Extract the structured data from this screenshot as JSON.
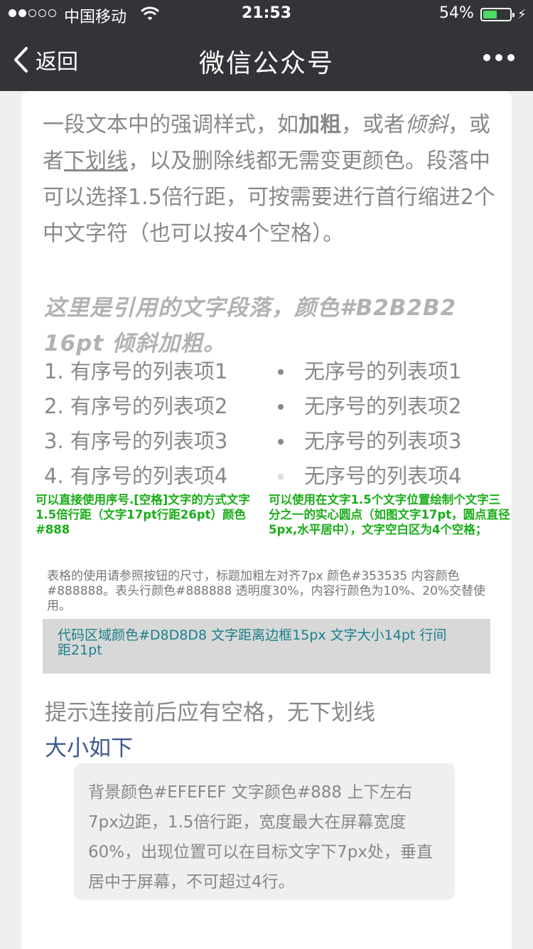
{
  "status_bar": {
    "carrier": "中国移动",
    "time": "21:53",
    "battery": "54%",
    "battery_level": 0.54
  },
  "nav": {
    "back_label": "返回",
    "title": "微信公众号"
  },
  "content": {
    "paragraph": {
      "p1": "一段文本中的强调样式，如",
      "bold": "加粗",
      "p2": "，或者",
      "italic": "倾斜",
      "p3": "，或者",
      "underline": "下划线",
      "p4": "，以及删除线都无需变更颜色。段落中可以选择1.5倍行距，可按需要进行首行缩进2个中文字符（也可以按4个空格）。"
    },
    "quote": "这里是引用的文字段落，颜色#B2B2B2 16pt 倾斜加粗。",
    "ordered_list": [
      "1. 有序号的列表项1",
      "2. 有序号的列表项2",
      "3. 有序号的列表项3",
      "4. 有序号的列表项4"
    ],
    "unordered_list": [
      "无序号的列表项1",
      "无序号的列表项2",
      "无序号的列表项3",
      "无序号的列表项4"
    ],
    "ordered_note": "可以直接使用序号.[空格]文字的方式文字1.5倍行距（文字17pt行距26pt）颜色#888",
    "unordered_note": "可以使用在文字1.5个文字位置绘制个文字三分之一的实心圆点（如图文字17pt，圆点直径5px,水平居中），文字空白区为4个空格；",
    "table_note": "表格的使用请参照按钮的尺寸，标题加粗左对齐7px 颜色#353535 内容颜色#888888。表头行颜色#888888 透明度30%，内容行颜色为10%、20%交替使用。",
    "code_text": "代码区域颜色#D8D8D8 文字距离边框15px 文字大小14pt 行间距21pt",
    "tip_text": "提示连接前后应有空格，无下划线",
    "link_text": "大小如下",
    "tooltip_text": "背景颜色#EFEFEF 文字颜色#888 上下左右7px边距，1.5倍行距，宽度最大在屏幕宽度60%，出现位置可以在目标文字下7px处，垂直居中于屏幕，不可超过4行。"
  },
  "colors": {
    "bar_background": "#333438",
    "text": "#888888",
    "quote": "#B2B2B2",
    "note_green": "#1AAD19",
    "code_bg": "#D8D8D8",
    "code_text": "#1A7F8C",
    "link": "#3E5A8E",
    "tooltip_bg": "#EFEFEF"
  },
  "icons": [
    "signal-dots-icon",
    "wifi-icon",
    "battery-icon",
    "charging-bolt-icon",
    "back-chevron-icon",
    "more-dots-icon"
  ]
}
